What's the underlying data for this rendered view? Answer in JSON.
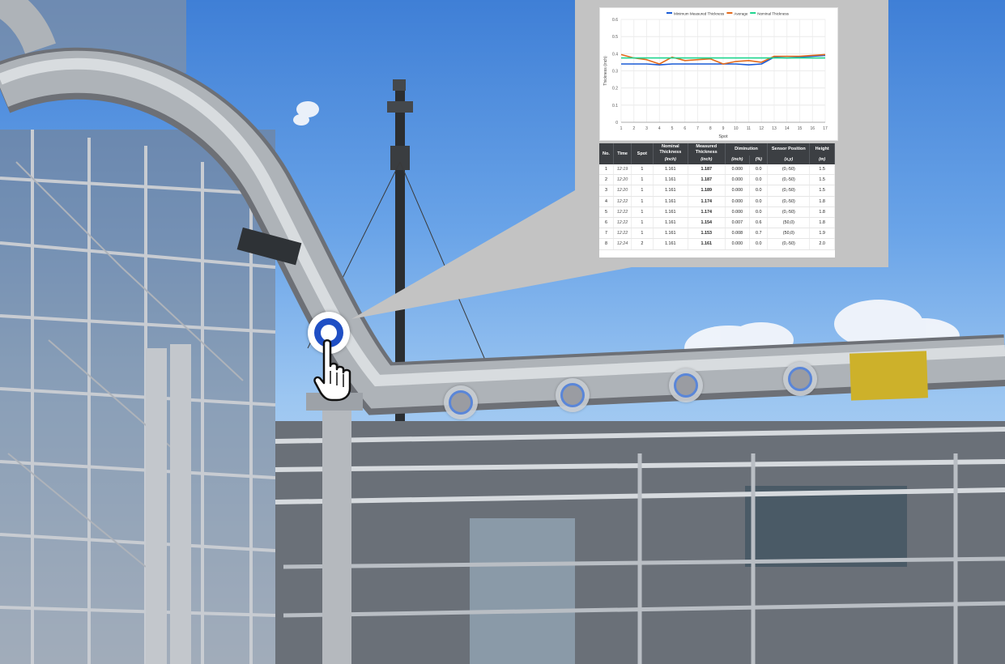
{
  "chart": {
    "legend": [
      {
        "name": "Minimum Measured Thickness",
        "color": "#1a5bd6"
      },
      {
        "name": "Average",
        "color": "#e36a1c"
      },
      {
        "name": "Nominal Thickness",
        "color": "#1fd58f"
      }
    ],
    "ylabel": "Thickness (inch)",
    "xlabel": "Spot"
  },
  "chart_data": {
    "type": "line",
    "x": [
      1,
      2,
      3,
      4,
      5,
      6,
      7,
      8,
      9,
      10,
      11,
      12,
      13,
      14,
      15,
      16,
      17
    ],
    "xlabel": "Spot",
    "ylabel": "Thickness (inch)",
    "ylim": [
      0,
      0.6
    ],
    "yticks": [
      "0",
      "0.1",
      "0.2",
      "0.3",
      "0.4",
      "0.5",
      "0.6"
    ],
    "grid": true,
    "legend_position": "top",
    "series": [
      {
        "name": "Minimum Measured Thickness",
        "color": "#1a5bd6",
        "values": [
          0.34,
          0.34,
          0.34,
          0.335,
          0.34,
          0.34,
          0.34,
          0.34,
          0.34,
          0.34,
          0.335,
          0.34,
          0.38,
          0.375,
          0.38,
          0.385,
          0.39
        ]
      },
      {
        "name": "Average",
        "color": "#e36a1c",
        "values": [
          0.395,
          0.375,
          0.365,
          0.34,
          0.38,
          0.36,
          0.365,
          0.37,
          0.34,
          0.355,
          0.36,
          0.35,
          0.385,
          0.385,
          0.385,
          0.39,
          0.395
        ]
      },
      {
        "name": "Nominal Thickness",
        "color": "#1fd58f",
        "values": [
          0.375,
          0.375,
          0.375,
          0.375,
          0.375,
          0.375,
          0.375,
          0.375,
          0.375,
          0.375,
          0.375,
          0.375,
          0.375,
          0.375,
          0.375,
          0.375,
          0.375
        ]
      }
    ]
  },
  "table": {
    "headers": [
      "No.",
      "Time",
      "Spot",
      "Nominal Thickness",
      "Measured Thickness",
      "Diminution",
      "Sensor Position",
      "Height"
    ],
    "units": [
      "",
      "",
      "",
      "(inch)",
      "(inch)",
      "(inch)",
      "(%)",
      "(x,y)",
      "(m)"
    ],
    "rows": [
      [
        "1",
        "12:19",
        "1",
        "1.161",
        "1.187",
        "0.000",
        "0.0",
        "(0,-50)",
        "1.5"
      ],
      [
        "2",
        "12:20",
        "1",
        "1.161",
        "1.187",
        "0.000",
        "0.0",
        "(0,-50)",
        "1.5"
      ],
      [
        "3",
        "12:20",
        "1",
        "1.161",
        "1.189",
        "0.000",
        "0.0",
        "(0,-50)",
        "1.5"
      ],
      [
        "4",
        "12:22",
        "1",
        "1.161",
        "1.174",
        "0.000",
        "0.0",
        "(0,-50)",
        "1.8"
      ],
      [
        "5",
        "12:22",
        "1",
        "1.161",
        "1.174",
        "0.000",
        "0.0",
        "(0,-50)",
        "1.8"
      ],
      [
        "6",
        "12:22",
        "1",
        "1.161",
        "1.154",
        "0.007",
        "0.6",
        "(50,0)",
        "1.8"
      ],
      [
        "7",
        "12:22",
        "1",
        "1.161",
        "1.153",
        "0.008",
        "0.7",
        "(50,0)",
        "1.9"
      ],
      [
        "8",
        "12:24",
        "2",
        "1.161",
        "1.161",
        "0.000",
        "0.0",
        "(0,-50)",
        "2.0"
      ]
    ]
  },
  "markers": {
    "active_icon": "hand-pointer-icon",
    "count_inactive": 4
  }
}
